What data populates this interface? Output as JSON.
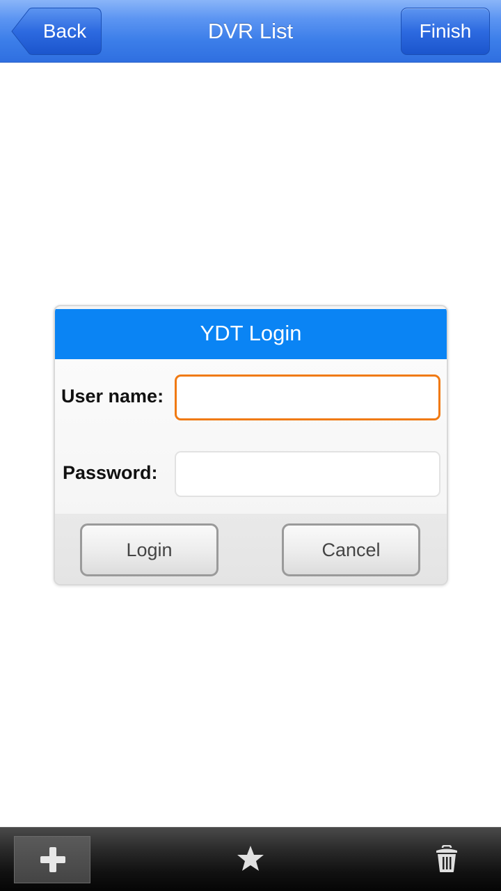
{
  "header": {
    "title": "DVR List",
    "back_label": "Back",
    "finish_label": "Finish"
  },
  "dialog": {
    "title": "YDT Login",
    "username_label": "User name:",
    "username_value": "",
    "password_label": "Password:",
    "password_value": "",
    "login_label": "Login",
    "cancel_label": "Cancel"
  },
  "toolbar": {
    "icons": [
      "plus-icon",
      "star-icon",
      "trash-icon"
    ]
  },
  "colors": {
    "nav_blue": "#3c7ee9",
    "dialog_header": "#0a84f4",
    "focus_orange": "#f07a13",
    "toolbar_dark": "#111111"
  }
}
